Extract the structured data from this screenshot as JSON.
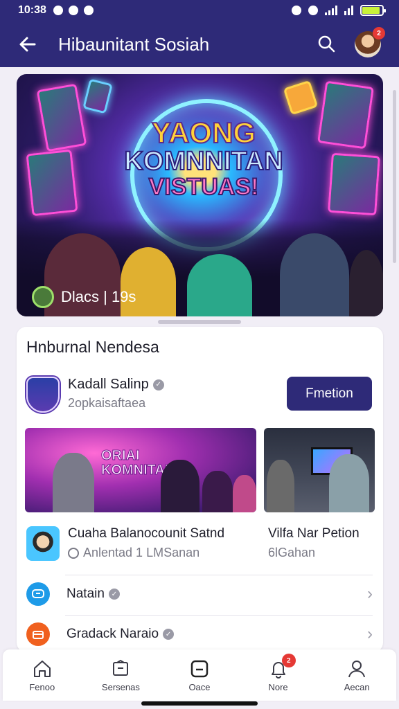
{
  "status_bar": {
    "time": "10:38"
  },
  "header": {
    "title": "Hibaunitant Sosiah",
    "notification_count": "2"
  },
  "hero": {
    "headline_l1": "YAONG",
    "headline_l2": "KOMNNITAN",
    "headline_l3": "VISTUAS!",
    "caption": "Dlacs | 19s"
  },
  "section": {
    "title": "Hnburnal Nendesa"
  },
  "host": {
    "name": "Kadall Salinp",
    "subtitle": "2opkaisaftaea",
    "follow_label": "Fmetion"
  },
  "events": [
    {
      "stage_text_1": "ORIAI",
      "stage_text_2": "KOMNITANS",
      "title": "Cuaha Balanocounit Satnd",
      "subtitle": "Anlentad 1 LMSanan"
    },
    {
      "title": "Vilfa Nar Petion",
      "subtitle": "6lGahan"
    }
  ],
  "list": [
    {
      "label": "Natain",
      "icon": "chat-icon",
      "color": "#1e9be8"
    },
    {
      "label": "Gradack Naraio",
      "icon": "gift-icon",
      "color": "#f0601e"
    }
  ],
  "nav": [
    {
      "label": "Fenoo",
      "icon": "home-icon"
    },
    {
      "label": "Sersenas",
      "icon": "explore-icon"
    },
    {
      "label": "Oace",
      "icon": "create-icon"
    },
    {
      "label": "Nore",
      "icon": "notification-icon",
      "badge": "2"
    },
    {
      "label": "Aecan",
      "icon": "profile-icon"
    }
  ],
  "colors": {
    "primary": "#2e2a78",
    "battery": "#c9f23a",
    "badge": "#e53935"
  }
}
